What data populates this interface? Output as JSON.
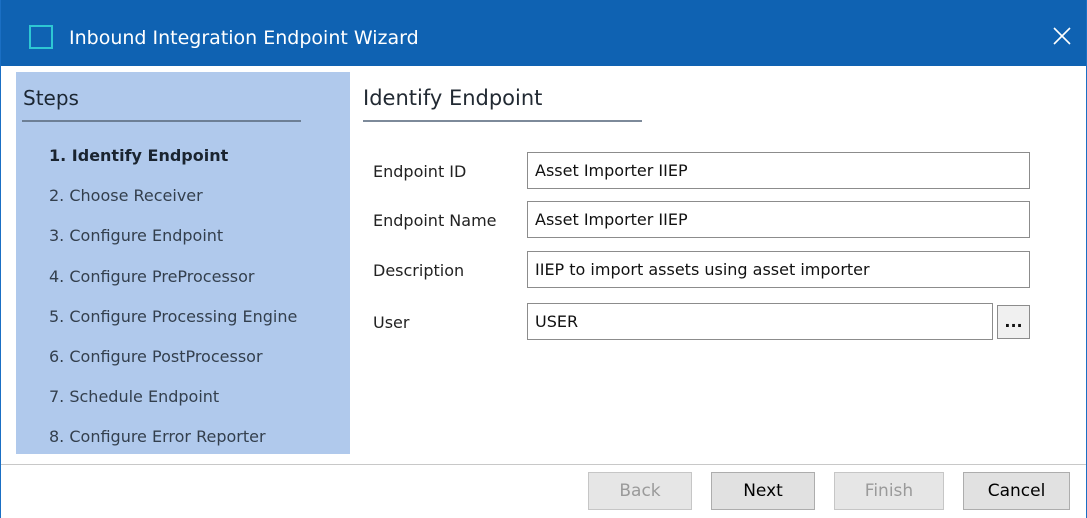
{
  "window": {
    "title": "Inbound Integration Endpoint Wizard",
    "accent_color": "#0f62b2",
    "app_icon": "window-icon",
    "close_icon": "close-icon"
  },
  "steps_panel": {
    "title": "Steps",
    "background_color": "#b0c9ec",
    "active_index": 0,
    "items": [
      "1. Identify Endpoint",
      "2. Choose Receiver",
      "3. Configure Endpoint",
      "4. Configure PreProcessor",
      "5. Configure Processing Engine",
      "6. Configure PostProcessor",
      "7. Schedule Endpoint",
      "8. Configure Error Reporter"
    ]
  },
  "main": {
    "title": "Identify Endpoint",
    "fields": {
      "endpoint_id": {
        "label": "Endpoint ID",
        "value": "Asset Importer IIEP"
      },
      "endpoint_name": {
        "label": "Endpoint Name",
        "value": "Asset Importer IIEP"
      },
      "description": {
        "label": "Description",
        "value": "IIEP to import assets using asset importer"
      },
      "user": {
        "label": "User",
        "value": "USER",
        "browse_label": "..."
      }
    }
  },
  "footer": {
    "back_label": "Back",
    "next_label": "Next",
    "finish_label": "Finish",
    "cancel_label": "Cancel",
    "back_enabled": false,
    "next_enabled": true,
    "finish_enabled": false,
    "cancel_enabled": true
  }
}
